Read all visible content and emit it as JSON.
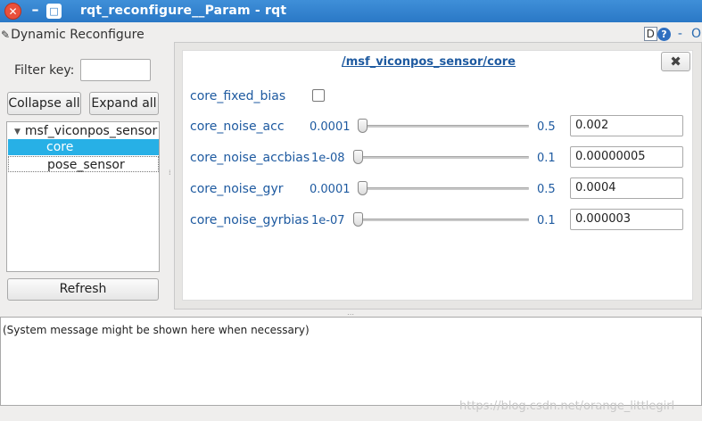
{
  "window": {
    "title": "rqt_reconfigure__Param - rqt",
    "close_glyph": "✕",
    "min_glyph": "–",
    "max_glyph": "□"
  },
  "plugin": {
    "title": "Dynamic Reconfigure",
    "d_label": "D",
    "help_label": "?",
    "dash_label": "-",
    "o_label": "O"
  },
  "filter": {
    "label": "Filter key:",
    "value": ""
  },
  "buttons": {
    "collapse_all": "Collapse all",
    "expand_all": "Expand all",
    "refresh": "Refresh"
  },
  "tree": {
    "root": "msf_viconpos_sensor",
    "children": [
      "core",
      "pose_sensor"
    ],
    "selected": "core"
  },
  "panel": {
    "namespace": "/msf_viconpos_sensor/core",
    "close_label": "✖",
    "params": [
      {
        "name": "core_fixed_bias",
        "type": "bool",
        "value": false
      },
      {
        "name": "core_noise_acc",
        "min": "0.0001",
        "max": "0.5",
        "value": "0.002"
      },
      {
        "name": "core_noise_accbias",
        "min": "1e-08",
        "max": "0.1",
        "value": "0.00000005"
      },
      {
        "name": "core_noise_gyr",
        "min": "0.0001",
        "max": "0.5",
        "value": "0.0004"
      },
      {
        "name": "core_noise_gyrbias",
        "min": "1e-07",
        "max": "0.1",
        "value": "0.000003"
      }
    ]
  },
  "console": {
    "message": "(System message might be shown here when necessary)"
  },
  "watermark": "https://blog.csdn.net/orange_littlegirl"
}
